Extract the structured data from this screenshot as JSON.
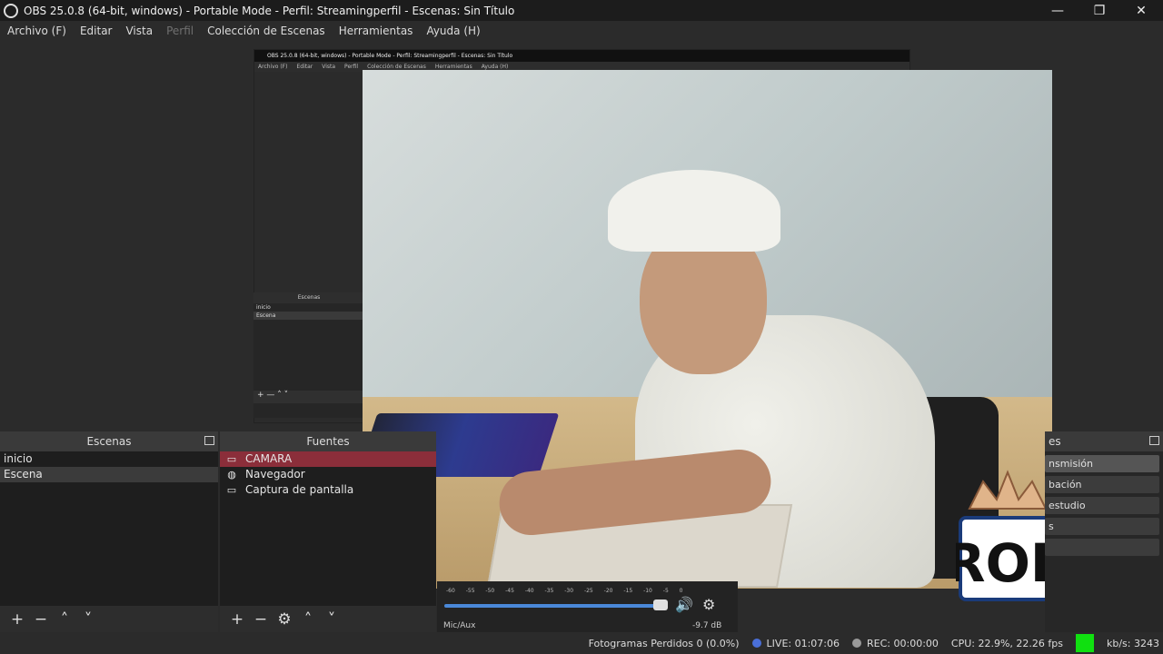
{
  "window": {
    "title": "OBS 25.0.8 (64-bit, windows) - Portable Mode - Perfil: Streamingperfil - Escenas: Sin Título",
    "minimize": "—",
    "maximize": "❐",
    "close": "✕"
  },
  "menu": [
    "Archivo (F)",
    "Editar",
    "Vista",
    "Perfil",
    "Colección de Escenas",
    "Herramientas",
    "Ayuda (H)"
  ],
  "nested_preview": {
    "title": "OBS 25.0.8 (64-bit, windows) - Portable Mode - Perfil: Streamingperfil - Escenas: Sin Título",
    "menu": [
      "Archivo (F)",
      "Editar",
      "Vista",
      "Perfil",
      "Colección de Escenas",
      "Herramientas",
      "Ayuda (H)"
    ],
    "scenes_header": "Escenas",
    "scenes": [
      "inicio",
      "Escena"
    ],
    "tools": "+ — ˄ ˅"
  },
  "scenes_dock": {
    "header": "Escenas",
    "items": [
      "inicio",
      "Escena"
    ],
    "selected": "Escena"
  },
  "sources_dock": {
    "header": "Fuentes",
    "items": [
      {
        "label": "CAMARA",
        "icon": "folder-icon"
      },
      {
        "label": "Navegador",
        "icon": "globe-icon"
      },
      {
        "label": "Captura de pantalla",
        "icon": "monitor-icon"
      }
    ]
  },
  "mixer": {
    "ticks": "-60 -55 -50 -45 -40 -35 -30 -25 -20 -15 -10 -5 0",
    "channel": "Mic/Aux",
    "db": "-9.7 dB",
    "volume_fraction": 0.94
  },
  "controls": {
    "header": "es",
    "buttons": [
      "nsmisión",
      "bación",
      "estudio",
      "s",
      ""
    ]
  },
  "status": {
    "dropped": "Fotogramas Perdidos 0 (0.0%)",
    "live": "LIVE: 01:07:06",
    "rec": "REC: 00:00:00",
    "cpu": "CPU: 22.9%, 22.26 fps",
    "kbps": "kb/s: 3243",
    "health_color": "#10e010"
  },
  "watermark": {
    "text": "ROB"
  }
}
